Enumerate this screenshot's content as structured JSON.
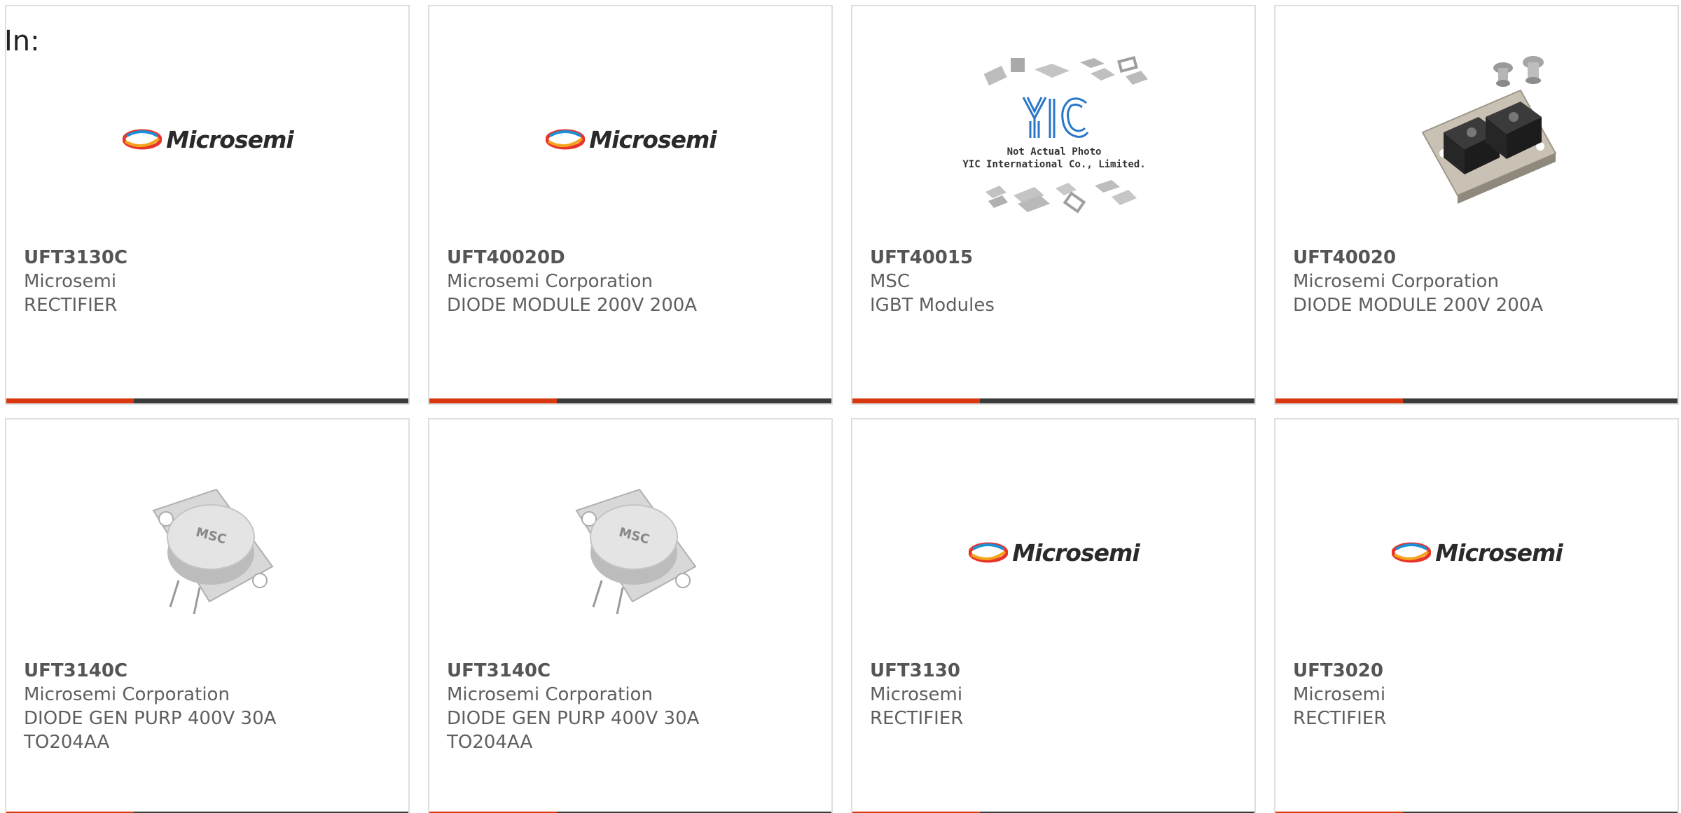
{
  "header": {
    "in_label": "In:"
  },
  "colors": {
    "accent": "#d8380f",
    "bar": "#3b3b3b",
    "border": "#dedede",
    "text": "#5f5f5f"
  },
  "products": [
    {
      "part": "UFT3130C",
      "manufacturer": "Microsemi",
      "description": "RECTIFIER",
      "package": "",
      "image": "microsemi-logo"
    },
    {
      "part": "UFT40020D",
      "manufacturer": "Microsemi Corporation",
      "description": "DIODE MODULE 200V 200A",
      "package": "",
      "image": "microsemi-logo"
    },
    {
      "part": "UFT40015",
      "manufacturer": "MSC",
      "description": "IGBT Modules",
      "package": "",
      "image": "yic-placeholder",
      "image_caption_1": "Not Actual Photo",
      "image_caption_2": "YIC International Co., Limited.",
      "image_logo_text": "YIC"
    },
    {
      "part": "UFT40020",
      "manufacturer": "Microsemi Corporation",
      "description": "DIODE MODULE 200V 200A",
      "package": "",
      "image": "diode-module-photo"
    },
    {
      "part": "UFT3140C",
      "manufacturer": "Microsemi Corporation",
      "description": "DIODE GEN PURP 400V 30A",
      "package": "TO204AA",
      "image": "to204-package-photo",
      "image_mark": "MSC"
    },
    {
      "part": "UFT3140C",
      "manufacturer": "Microsemi Corporation",
      "description": "DIODE GEN PURP 400V 30A",
      "package": "TO204AA",
      "image": "to204-package-photo",
      "image_mark": "MSC"
    },
    {
      "part": "UFT3130",
      "manufacturer": "Microsemi",
      "description": "RECTIFIER",
      "package": "",
      "image": "microsemi-logo"
    },
    {
      "part": "UFT3020",
      "manufacturer": "Microsemi",
      "description": "RECTIFIER",
      "package": "",
      "image": "microsemi-logo"
    }
  ],
  "logo": {
    "microsemi_word": "Microsemi"
  }
}
